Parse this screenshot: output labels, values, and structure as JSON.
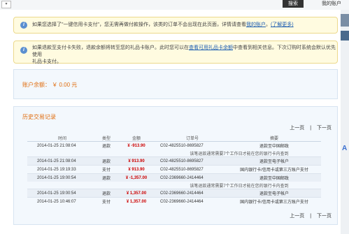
{
  "topbar": {
    "dropdown_label": "▾",
    "search_label": "搜索",
    "account_label": "我的账户"
  },
  "notice1": {
    "text": "如果您选择了\"一键信用卡支付\"，您无需再做付款操作，该类的订单不会出现在此页面，详情请查看",
    "link": "我的账户",
    "suffix": "。",
    "more": "(了解更多)"
  },
  "notice2": {
    "line1_pre": "如果退款至支付卡失败，退款余额将转至您的礼品卡账户。此时您可以在",
    "line1_link": "查看可用礼品卡余额",
    "line1_post": "中查看到相关信息。下次订购时系统会默认优先使用",
    "line2": "礼品卡支付。"
  },
  "balance": {
    "label": "账户余额： ￥ 0.00  元"
  },
  "history": {
    "title": "历史交易记录",
    "pager": {
      "prev": "上一页",
      "sep": "|",
      "next": "下一页"
    },
    "columns": [
      "时间",
      "类型",
      "金额",
      "订单号",
      "摘要"
    ],
    "rows": [
      {
        "time": "2014-01-25 21:08:04",
        "type": "退款",
        "amount": "¥ -913.90",
        "order": "C02-4825510-8695827",
        "summary": "退款至中国邮政"
      },
      {
        "note": "该笔退款通常需要7个工作日才能在您的银行卡内查到"
      },
      {
        "time": "2014-01-25 21:08:04",
        "type": "退款",
        "amount": "¥ 913.90",
        "order": "C02-4825510-8695827",
        "summary": "退款至电子帐户"
      },
      {
        "time": "2014-01-25 19:19:33",
        "type": "支付",
        "amount": "¥ 913.90",
        "order": "C02-4825510-8695827",
        "summary": "国内银行卡/信用卡或第三方账户支付"
      },
      {
        "time": "2014-01-25 19:00:54",
        "type": "退款",
        "amount": "¥ -1,357.00",
        "order": "C02-2369660-2414464",
        "summary": "退款至中国邮政"
      },
      {
        "note": "该笔退款通常需要7个工作日才能在您的银行卡内查到"
      },
      {
        "time": "2014-01-25 19:00:54",
        "type": "退款",
        "amount": "¥ 1,357.00",
        "order": "C02-2369660-2414464",
        "summary": "退款至电子帐户"
      },
      {
        "time": "2014-01-25 10:46:07",
        "type": "支付",
        "amount": "¥ 1,357.00",
        "order": "C02-2369660-2414464",
        "summary": "国内银行卡/信用卡或第三方账户支付"
      }
    ]
  },
  "side": {
    "letter": "A"
  }
}
